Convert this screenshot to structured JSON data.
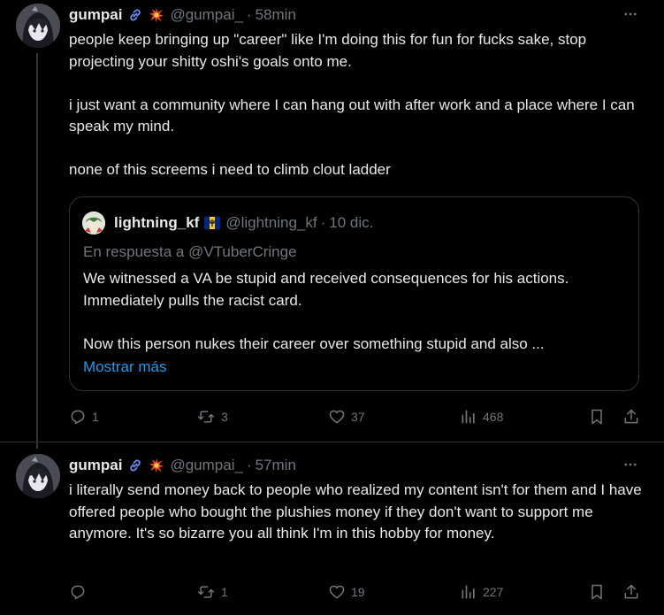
{
  "tweets": [
    {
      "author": {
        "name": "gumpai",
        "handle": "@gumpai_",
        "badges": [
          "link-icon",
          "explosion-emoji"
        ]
      },
      "time": "58min",
      "paragraphs": [
        "people keep bringing up \"career\" like I'm doing this for fun for fucks sake, stop projecting your shitty oshi's goals onto me.",
        "i just want a community where I can hang out with after work and a place where I can speak my mind.",
        "none of this screems i need to climb clout ladder"
      ],
      "quote": {
        "author": {
          "name": "lightning_kf",
          "handle": "@lightning_kf",
          "flag": "barbados-flag"
        },
        "date": "10 dic.",
        "reply_to": "En respuesta a @VTuberCringe",
        "paragraphs": [
          "We witnessed a VA be stupid and received consequences for his actions.  Immediately pulls the racist card.",
          "Now this person nukes their career over something stupid and also ..."
        ],
        "show_more": "Mostrar más"
      },
      "stats": {
        "replies": "1",
        "reposts": "3",
        "likes": "37",
        "views": "468"
      }
    },
    {
      "author": {
        "name": "gumpai",
        "handle": "@gumpai_",
        "badges": [
          "link-icon",
          "explosion-emoji"
        ]
      },
      "time": "57min",
      "paragraphs": [
        "i literally send money back to people who realized my content isn't for them and I have offered people who bought the plushies money if they don't want to support me anymore. It's so bizarre you all think I'm in this hobby for money."
      ],
      "stats": {
        "replies": "",
        "reposts": "1",
        "likes": "19",
        "views": "227"
      }
    }
  ],
  "separator": "·",
  "colors": {
    "background": "#000000",
    "text": "#e7e9ea",
    "muted": "#71767b",
    "link": "#1d9bf0",
    "border": "#2f3336"
  }
}
